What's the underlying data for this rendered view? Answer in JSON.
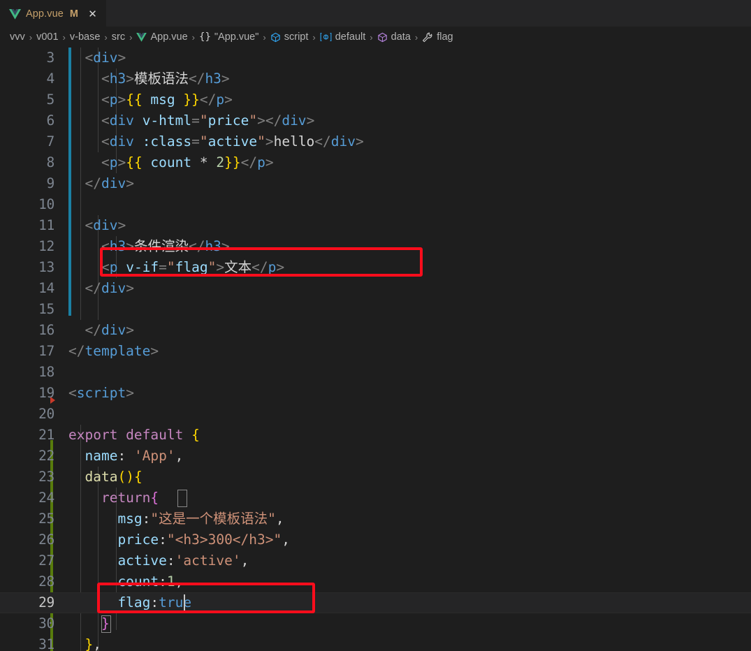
{
  "window": {
    "theme": "vscode-dark-plus",
    "accent_colors": {
      "tab_modified": "#c5a06a",
      "gutter_modified": "#1b80a4",
      "gutter_added": "#587c0c",
      "annotation_red": "#fc0d1c",
      "editor_background": "#1e1e1e",
      "tabbar_background": "#252526"
    }
  },
  "tab": {
    "label": "App.vue",
    "dirty_badge": "M",
    "close_label": "✕",
    "icon": "vue-file-icon"
  },
  "breadcrumb": {
    "items": [
      {
        "label": "vvv",
        "icon": "none"
      },
      {
        "label": "v001",
        "icon": "none"
      },
      {
        "label": "v-base",
        "icon": "none"
      },
      {
        "label": "src",
        "icon": "none"
      },
      {
        "label": "App.vue",
        "icon": "vue-file-icon"
      },
      {
        "label": "\"App.vue\"",
        "icon": "json-object-icon"
      },
      {
        "label": "script",
        "icon": "module-cube-icon"
      },
      {
        "label": "default",
        "icon": "export-default-icon"
      },
      {
        "label": "data",
        "icon": "method-cube-icon"
      },
      {
        "label": "flag",
        "icon": "property-wrench-icon"
      }
    ],
    "separator": "›"
  },
  "editor": {
    "language": "vue",
    "first_visible_line": 3,
    "last_visible_line": 31,
    "current_line": 29,
    "cursor": {
      "line": 29,
      "column": 14,
      "after_text": "flag:true"
    },
    "lines": [
      {
        "n": 3,
        "text": "  <div>"
      },
      {
        "n": 4,
        "text": "    <h3>模板语法</h3>"
      },
      {
        "n": 5,
        "text": "    <p>{{ msg }}</p>"
      },
      {
        "n": 6,
        "text": "    <div v-html=\"price\"></div>"
      },
      {
        "n": 7,
        "text": "    <div :class=\"active\">hello</div>"
      },
      {
        "n": 8,
        "text": "    <p>{{ count * 2}}</p>"
      },
      {
        "n": 9,
        "text": "  </div>"
      },
      {
        "n": 10,
        "text": ""
      },
      {
        "n": 11,
        "text": "  <div>"
      },
      {
        "n": 12,
        "text": "    <h3>条件渲染</h3>"
      },
      {
        "n": 13,
        "text": "    <p v-if=\"flag\">文本</p>"
      },
      {
        "n": 14,
        "text": "  </div>"
      },
      {
        "n": 15,
        "text": ""
      },
      {
        "n": 16,
        "text": "  </div>"
      },
      {
        "n": 17,
        "text": "</template>"
      },
      {
        "n": 18,
        "text": ""
      },
      {
        "n": 19,
        "text": "<script>"
      },
      {
        "n": 20,
        "text": ""
      },
      {
        "n": 21,
        "text": "export default {"
      },
      {
        "n": 22,
        "text": "  name: 'App',"
      },
      {
        "n": 23,
        "text": "  data(){"
      },
      {
        "n": 24,
        "text": "    return{"
      },
      {
        "n": 25,
        "text": "      msg:\"这是一个模板语法\","
      },
      {
        "n": 26,
        "text": "      price:\"<h3>300</h3>\","
      },
      {
        "n": 27,
        "text": "      active:'active',"
      },
      {
        "n": 28,
        "text": "      count:1,"
      },
      {
        "n": 29,
        "text": "      flag:true"
      },
      {
        "n": 30,
        "text": "    }"
      },
      {
        "n": 31,
        "text": "  },"
      }
    ],
    "gutter_indicators": [
      {
        "type": "modified",
        "from_line": 3,
        "to_line": 15,
        "color": "#1b80a4"
      },
      {
        "type": "added",
        "from_line": 23,
        "to_line": 31,
        "color": "#587c0c"
      },
      {
        "type": "fold-collapsed-marker",
        "line": 20,
        "color": "#c83a2a"
      }
    ]
  },
  "annotations": [
    {
      "name": "highlight-v-if-line",
      "target_line": 13,
      "color": "#fc0d1c"
    },
    {
      "name": "highlight-flag-true-line",
      "target_line": 29,
      "color": "#fc0d1c"
    }
  ]
}
